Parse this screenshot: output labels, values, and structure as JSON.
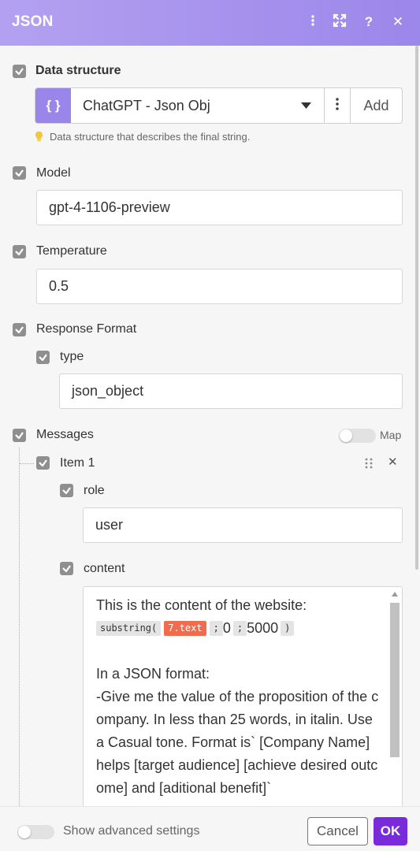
{
  "header": {
    "title": "JSON"
  },
  "data_structure": {
    "label": "Data structure",
    "icon": "{ }",
    "selected": "ChatGPT - Json Obj",
    "add_label": "Add",
    "hint": "Data structure that describes the final string."
  },
  "model": {
    "label": "Model",
    "value": "gpt-4-1106-preview"
  },
  "temperature": {
    "label": "Temperature",
    "value": "0.5"
  },
  "response_format": {
    "label": "Response Format",
    "type_label": "type",
    "type_value": "json_object"
  },
  "messages": {
    "label": "Messages",
    "map_label": "Map",
    "item": {
      "label": "Item 1",
      "role_label": "role",
      "role_value": "user",
      "content_label": "content",
      "content": {
        "line1": "This is the content of the website:",
        "fn": "substring(",
        "var": "7.text",
        "sep1": ";",
        "arg1": "0",
        "sep2": ";",
        "arg2": "5000",
        "close": ")",
        "para": "In a JSON format:",
        "body": "-Give me the value of the proposition of the company. In less than 25 words, in italin. Use a Casual tone. Format is` [Company Name] helps [target audience] [achieve desired outcome] and [aditional benefit]`"
      }
    }
  },
  "footer": {
    "advanced_label": "Show advanced settings",
    "cancel_label": "Cancel",
    "ok_label": "OK"
  },
  "colors": {
    "header": "#9c87ea",
    "accent": "#7a2bd9",
    "variable_pill": "#f26b4c"
  }
}
